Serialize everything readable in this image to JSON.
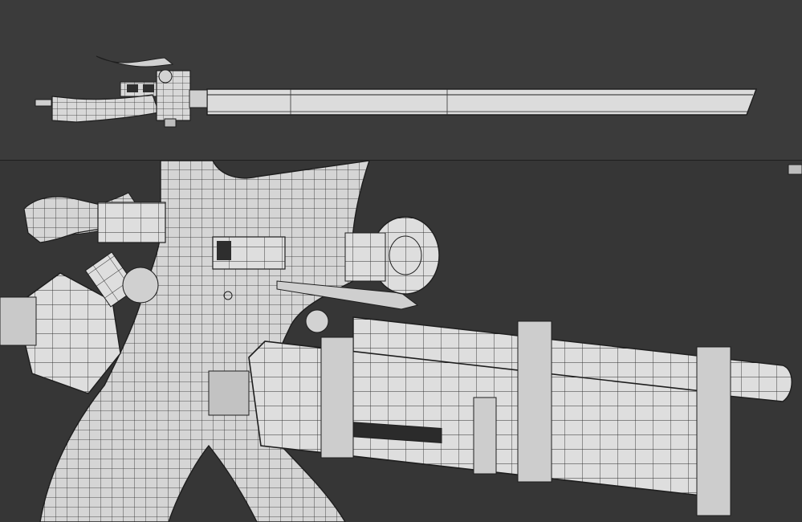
{
  "scene": {
    "description_viewports": [
      "top-viewport",
      "perspective-viewport"
    ],
    "colors": {
      "background_top": "#3b3b3b",
      "background_bottom": "#363636",
      "mesh_fill": "#d7d7d7",
      "wire": "#2a2a2a"
    }
  }
}
